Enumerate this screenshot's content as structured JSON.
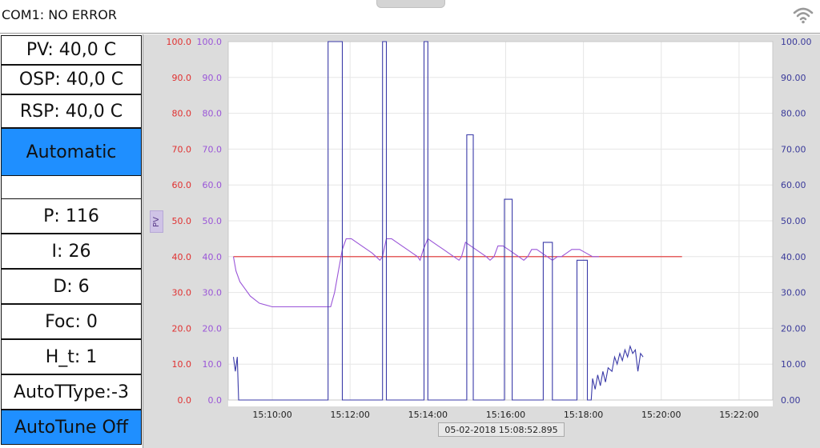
{
  "header": {
    "status": "COM1: NO ERROR",
    "wifi_icon": "wifi-icon"
  },
  "left_panel": {
    "pv": "PV: 40,0 C",
    "osp": "OSP: 40,0 C",
    "rsp": "RSP: 40,0 C",
    "mode_button": "Automatic",
    "p": "P: 116",
    "i": "I: 26",
    "d": "D: 6",
    "foc": "Foc: 0",
    "h_t": "H_t: 1",
    "autottype": "AutoTType:-3",
    "autotune_button": "AutoTune Off",
    "accent_color": "#1f8fff"
  },
  "chart": {
    "pv_tag": "PV",
    "timestamp": "05-02-2018  15:08:52.895"
  },
  "chart_data": {
    "type": "line",
    "x_ticks": [
      "15:10:00",
      "15:12:00",
      "15:14:00",
      "15:16:00",
      "15:18:00",
      "15:20:00",
      "15:22:00"
    ],
    "xlim": [
      "15:08:52",
      "15:22:52"
    ],
    "y_left_red_ticks": [
      "0.0",
      "10.0",
      "20.0",
      "30.0",
      "40.0",
      "50.0",
      "60.0",
      "70.0",
      "80.0",
      "90.0",
      "100.0"
    ],
    "y_left_purple_ticks": [
      "0.0",
      "10.0",
      "20.0",
      "30.0",
      "40.0",
      "50.0",
      "60.0",
      "70.0",
      "80.0",
      "90.0",
      "100.0"
    ],
    "y_right_ticks": [
      "0.00",
      "10.00",
      "20.00",
      "30.00",
      "40.00",
      "50.00",
      "60.00",
      "70.00",
      "80.00",
      "90.00",
      "100.00"
    ],
    "ylim": [
      0,
      100
    ],
    "grid": true,
    "colors": {
      "setpoint": "#e03030",
      "pv": "#9a55d8",
      "output": "#3a3aa8",
      "left_red_axis": "#e03030",
      "left_purple_axis": "#9a55d8",
      "right_axis": "#3a3a9a"
    },
    "series": [
      {
        "points": [
          [
            0,
            40
          ],
          [
            122,
            40
          ],
          [
            240,
            40
          ],
          [
            360,
            40
          ],
          [
            480,
            40
          ],
          [
            600,
            40
          ],
          [
            692,
            40
          ]
        ]
      },
      {
        "points": [
          [
            0,
            40
          ],
          [
            4,
            36
          ],
          [
            10,
            33
          ],
          [
            18,
            31
          ],
          [
            26,
            29
          ],
          [
            40,
            27
          ],
          [
            60,
            26
          ],
          [
            120,
            26
          ],
          [
            150,
            26
          ],
          [
            156,
            30
          ],
          [
            162,
            36
          ],
          [
            168,
            42
          ],
          [
            174,
            45
          ],
          [
            182,
            45
          ],
          [
            190,
            44
          ],
          [
            198,
            43
          ],
          [
            206,
            42
          ],
          [
            214,
            41
          ],
          [
            220,
            40
          ],
          [
            226,
            39
          ],
          [
            230,
            40
          ],
          [
            236,
            45
          ],
          [
            244,
            45
          ],
          [
            252,
            44
          ],
          [
            260,
            43
          ],
          [
            268,
            42
          ],
          [
            276,
            41
          ],
          [
            284,
            40
          ],
          [
            288,
            39
          ],
          [
            293,
            42
          ],
          [
            300,
            45
          ],
          [
            308,
            44
          ],
          [
            316,
            43
          ],
          [
            324,
            42
          ],
          [
            332,
            41
          ],
          [
            340,
            40
          ],
          [
            348,
            39
          ],
          [
            352,
            40
          ],
          [
            358,
            44
          ],
          [
            366,
            43
          ],
          [
            374,
            42
          ],
          [
            382,
            41
          ],
          [
            390,
            40
          ],
          [
            396,
            39
          ],
          [
            402,
            40
          ],
          [
            408,
            43
          ],
          [
            416,
            43
          ],
          [
            424,
            42
          ],
          [
            432,
            41
          ],
          [
            440,
            40
          ],
          [
            448,
            39
          ],
          [
            454,
            40
          ],
          [
            460,
            42
          ],
          [
            468,
            42
          ],
          [
            476,
            41
          ],
          [
            484,
            40
          ],
          [
            492,
            39
          ],
          [
            500,
            40
          ],
          [
            506,
            40
          ],
          [
            514,
            41
          ],
          [
            522,
            42
          ],
          [
            534,
            42
          ],
          [
            544,
            41
          ],
          [
            554,
            40
          ],
          [
            564,
            40
          ]
        ]
      },
      {
        "points": [
          [
            0,
            12
          ],
          [
            3,
            8
          ],
          [
            6,
            12
          ],
          [
            8,
            0
          ],
          [
            146,
            0
          ],
          [
            146,
            100
          ],
          [
            168,
            100
          ],
          [
            168,
            0
          ],
          [
            230,
            0
          ],
          [
            230,
            100
          ],
          [
            236,
            100
          ],
          [
            236,
            0
          ],
          [
            294,
            0
          ],
          [
            294,
            100
          ],
          [
            300,
            100
          ],
          [
            300,
            0
          ],
          [
            360,
            0
          ],
          [
            360,
            74
          ],
          [
            370,
            74
          ],
          [
            370,
            0
          ],
          [
            418,
            0
          ],
          [
            418,
            56
          ],
          [
            430,
            56
          ],
          [
            430,
            0
          ],
          [
            478,
            0
          ],
          [
            478,
            44
          ],
          [
            492,
            44
          ],
          [
            492,
            0
          ],
          [
            530,
            0
          ],
          [
            530,
            39
          ],
          [
            546,
            39
          ],
          [
            546,
            0
          ],
          [
            552,
            0
          ],
          [
            554,
            6
          ],
          [
            558,
            3
          ],
          [
            562,
            7
          ],
          [
            566,
            4
          ],
          [
            570,
            8
          ],
          [
            574,
            5
          ],
          [
            578,
            9
          ],
          [
            584,
            8
          ],
          [
            588,
            12
          ],
          [
            592,
            10
          ],
          [
            596,
            13
          ],
          [
            600,
            11
          ],
          [
            604,
            14
          ],
          [
            608,
            12
          ],
          [
            612,
            15
          ],
          [
            616,
            13
          ],
          [
            620,
            14
          ],
          [
            624,
            8
          ],
          [
            628,
            13
          ],
          [
            632,
            12
          ]
        ]
      }
    ]
  }
}
